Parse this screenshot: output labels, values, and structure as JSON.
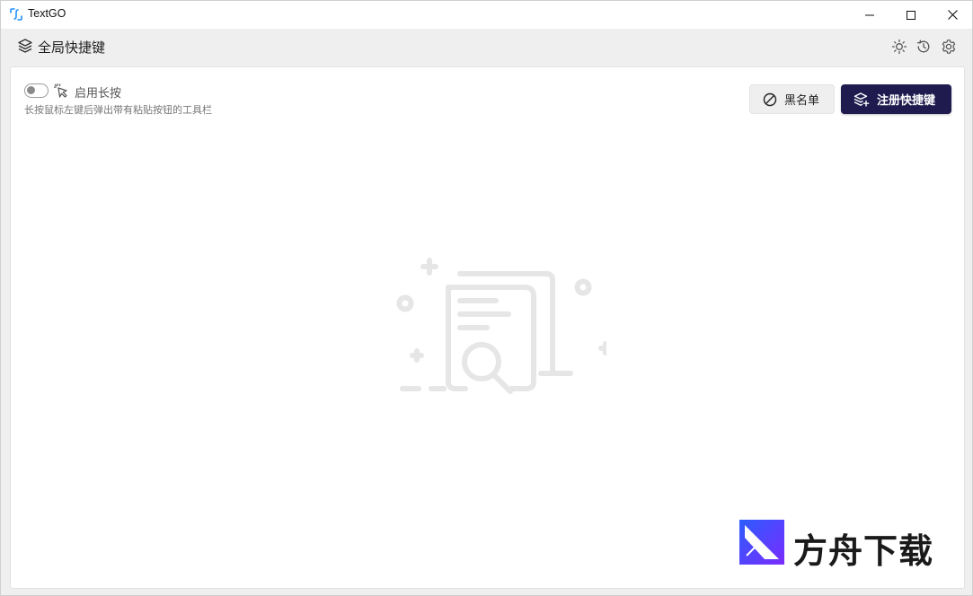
{
  "window": {
    "app_title": "TextGO"
  },
  "header": {
    "title": "全局快捷键"
  },
  "panel": {
    "long_press_label": "启用长按",
    "long_press_desc": "长按鼠标左键后弹出带有粘贴按钮的工具栏",
    "long_press_enabled": false,
    "blacklist_label": "黑名单",
    "register_label": "注册快捷键"
  },
  "icons": {
    "app": "textgo-logo-icon",
    "header": "layers-icon",
    "theme": "sun-icon",
    "history": "history-icon",
    "settings": "gear-icon",
    "cursor": "pointer-click-icon",
    "blacklist": "ban-icon",
    "register": "layers-plus-icon",
    "empty": "empty-search-document-illustration"
  },
  "watermark": {
    "text": "方舟下载"
  },
  "colors": {
    "accent": "#1f1b4f",
    "app_icon_blue": "#1e90ff",
    "background": "#efefef",
    "panel": "#ffffff"
  }
}
